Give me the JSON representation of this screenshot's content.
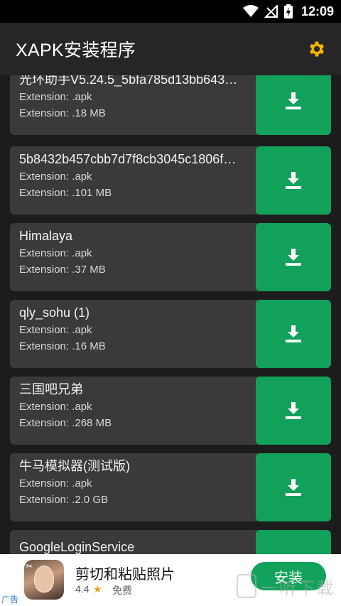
{
  "status_bar": {
    "time": "12:09"
  },
  "app_bar": {
    "title": "XAPK安装程序"
  },
  "items": [
    {
      "name": "光环助手V5.24.5_5bfa785d13bb643…",
      "extension": "Extension: .apk",
      "size": "Extension: .18 MB"
    },
    {
      "name": "5b8432b457cbb7d7f8cb3045c1806f…",
      "extension": "Extension: .apk",
      "size": "Extension: .101 MB"
    },
    {
      "name": "Himalaya",
      "extension": "Extension: .apk",
      "size": "Extension: .37 MB"
    },
    {
      "name": "qly_sohu (1)",
      "extension": "Extension: .apk",
      "size": "Extension: .16 MB"
    },
    {
      "name": "三国吧兄弟",
      "extension": "Extension: .apk",
      "size": "Extension: .268 MB"
    },
    {
      "name": "牛马模拟器(测试版)",
      "extension": "Extension: .apk",
      "size": "Extension: .2.0 GB"
    },
    {
      "name": "GoogleLoginService",
      "extension": "",
      "size": ""
    }
  ],
  "ad": {
    "label": "广告",
    "title": "剪切和粘贴照片",
    "rating": "4.4",
    "price": "免费",
    "install_label": "安装",
    "watermark": "一听下载"
  },
  "colors": {
    "accent": "#11a15a",
    "settings_icon": "#f4b400",
    "card_bg": "#3a3a3a",
    "app_bar": "#262626"
  }
}
